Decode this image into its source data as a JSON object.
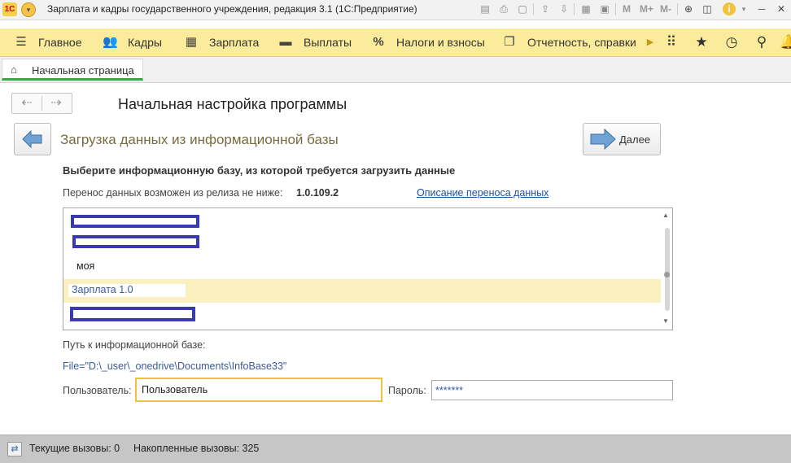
{
  "app": {
    "title": "Зарплата и кадры государственного учреждения, редакция 3.1  (1С:Предприятие)",
    "logo_text": "1С"
  },
  "toolbar": {
    "icons": [
      "save-icon",
      "print-icon",
      "preview-icon",
      "upload-icon",
      "download-icon",
      "calculator-icon",
      "calendar-icon"
    ],
    "memory_buttons": [
      "M",
      "M+",
      "M-"
    ]
  },
  "main_nav": {
    "items": [
      {
        "label": "Главное",
        "icon": "hamburger-icon"
      },
      {
        "label": "Кадры",
        "icon": "people-icon"
      },
      {
        "label": "Зарплата",
        "icon": "calculator-icon"
      },
      {
        "label": "Выплаты",
        "icon": "wallet-icon"
      },
      {
        "label": "Налоги и взносы",
        "icon": "percent-icon"
      },
      {
        "label": "Отчетность, справки",
        "icon": "reports-icon"
      }
    ],
    "right_icons": [
      "grid-icon",
      "star-icon",
      "history-icon",
      "search-icon",
      "bell-icon"
    ]
  },
  "tabs": {
    "home_label": "Начальная страница"
  },
  "form": {
    "title": "Начальная настройка программы",
    "step_title": "Загрузка данных из информационной базы",
    "next_label": "Далее",
    "instruction": "Выберите информационную базу, из которой требуется загрузить данные",
    "release_label": "Перенос данных возможен из релиза не ниже:",
    "release_value": "1.0.109.2",
    "description_link": "Описание переноса данных",
    "infobases": [
      {
        "text": "",
        "redacted": true,
        "selected": false
      },
      {
        "text": "",
        "redacted": true,
        "selected": false
      },
      {
        "text": "моя",
        "redacted": false,
        "selected": false
      },
      {
        "text": "Зарплата 1.0",
        "redacted": false,
        "selected": true
      },
      {
        "text": "",
        "redacted": true,
        "selected": false
      }
    ],
    "path_label": "Путь к информационной базе:",
    "path_value": "File=\"D:\\_user\\_onedrive\\Documents\\InfoBase33\"",
    "user_label": "Пользователь:",
    "user_value": "Пользователь",
    "password_label": "Пароль:",
    "password_value": "*******"
  },
  "status": {
    "current_calls": "Текущие вызовы: 0",
    "accumulated_calls": "Накопленные вызовы: 325"
  },
  "colors": {
    "nav_bg": "#fbec9b",
    "tab_accent": "#38a848",
    "selected_row": "#fbf0c0",
    "link": "#1f4fa0",
    "input_focus": "#f0c040"
  }
}
